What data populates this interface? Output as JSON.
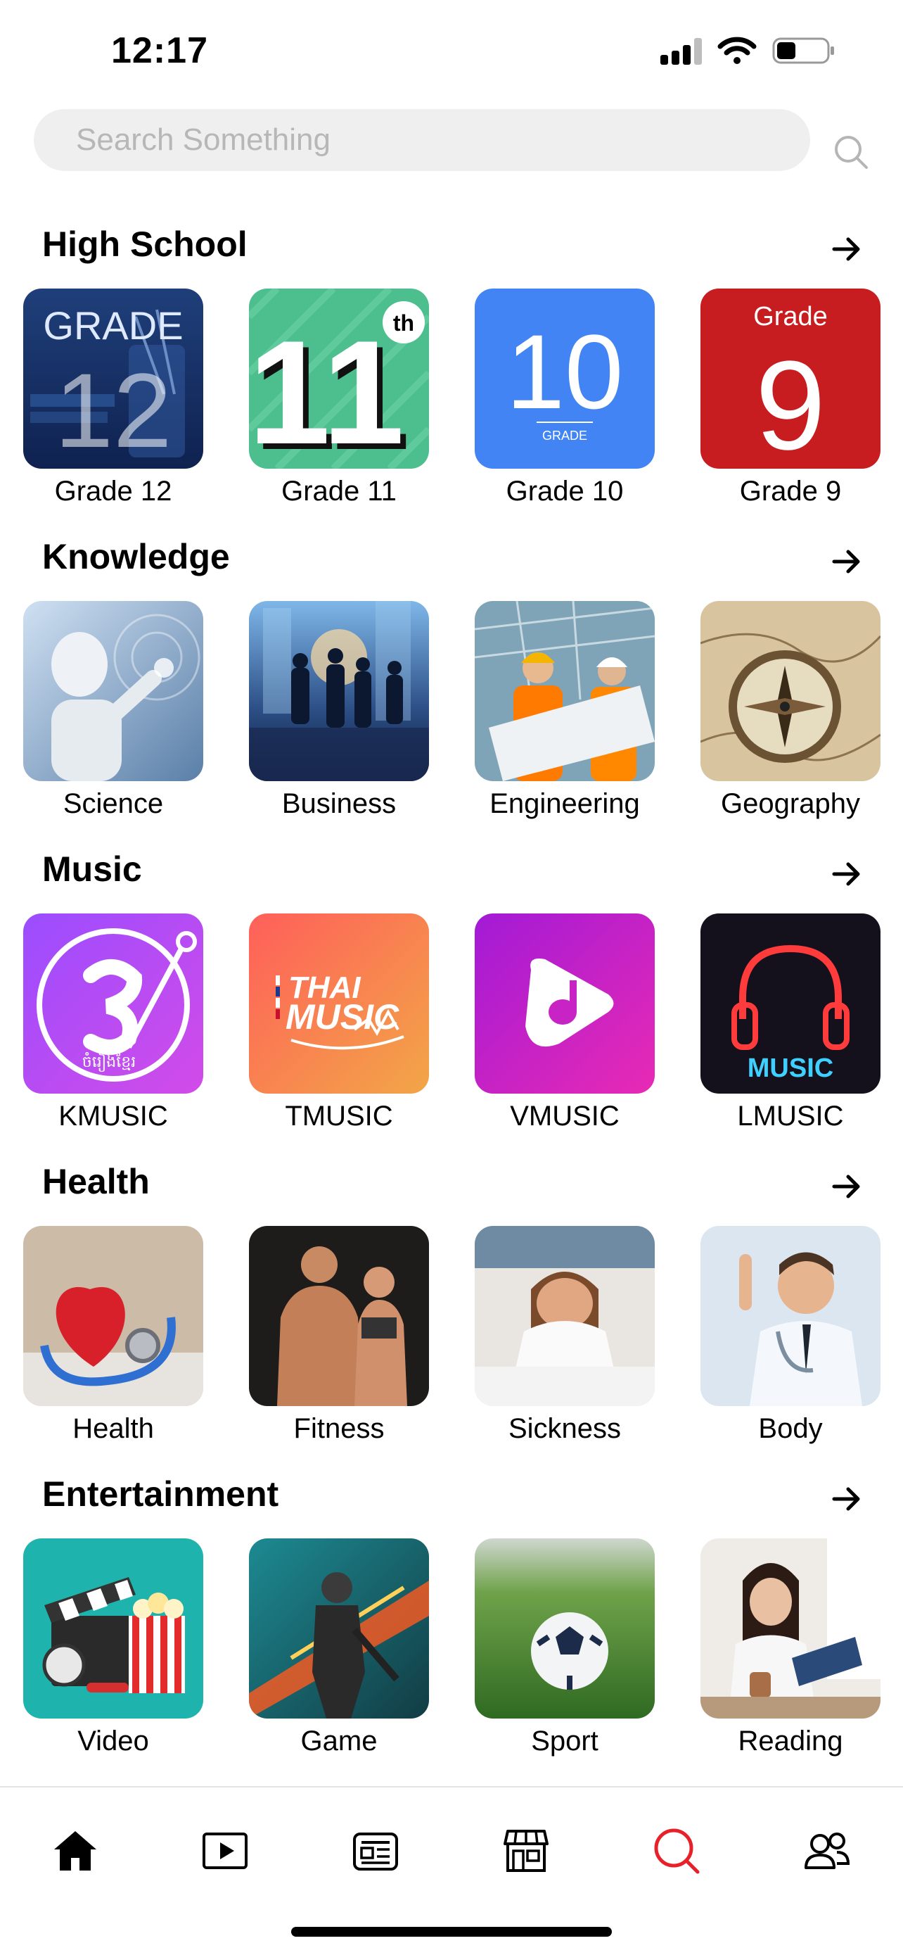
{
  "status_bar": {
    "time": "12:17"
  },
  "search": {
    "placeholder": "Search Something",
    "value": ""
  },
  "sections": [
    {
      "title": "High School",
      "items": [
        {
          "label": "Grade 12",
          "icon": "grade-12-image"
        },
        {
          "label": "Grade 11",
          "icon": "grade-11-image"
        },
        {
          "label": "Grade 10",
          "icon": "grade-10-image"
        },
        {
          "label": "Grade 9",
          "icon": "grade-9-image"
        }
      ]
    },
    {
      "title": "Knowledge",
      "items": [
        {
          "label": "Science",
          "icon": "robot-image"
        },
        {
          "label": "Business",
          "icon": "business-people-image"
        },
        {
          "label": "Engineering",
          "icon": "engineers-image"
        },
        {
          "label": "Geography",
          "icon": "compass-map-image"
        }
      ]
    },
    {
      "title": "Music",
      "items": [
        {
          "label": "KMUSIC",
          "icon": "kmusic-logo"
        },
        {
          "label": "TMUSIC",
          "icon": "thai-music-logo"
        },
        {
          "label": "VMUSIC",
          "icon": "vmusic-logo"
        },
        {
          "label": "LMUSIC",
          "icon": "neon-headphones-logo"
        }
      ]
    },
    {
      "title": "Health",
      "items": [
        {
          "label": "Health",
          "icon": "heart-stethoscope-image"
        },
        {
          "label": "Fitness",
          "icon": "fitness-couple-image"
        },
        {
          "label": "Sickness",
          "icon": "sick-woman-image"
        },
        {
          "label": "Body",
          "icon": "doctor-image"
        }
      ]
    },
    {
      "title": "Entertainment",
      "items": [
        {
          "label": "Video",
          "icon": "clapperboard-popcorn-image"
        },
        {
          "label": "Game",
          "icon": "soldier-game-image"
        },
        {
          "label": "Sport",
          "icon": "soccer-ball-image"
        },
        {
          "label": "Reading",
          "icon": "woman-reading-image"
        }
      ]
    }
  ],
  "tile_art": {
    "grade12": {
      "top": "GRADE",
      "num": "12"
    },
    "grade11": {
      "num": "11",
      "sup": "th"
    },
    "grade10": {
      "num": "10",
      "sub": "GRADE"
    },
    "grade9": {
      "top": "Grade",
      "num": "9"
    },
    "kmusic": {
      "caption": "ចំរៀងខ្មែរ"
    },
    "tmusic": {
      "line1": "THAI",
      "line2": "MUSIC"
    },
    "lmusic": {
      "caption": "MUSIC"
    }
  },
  "bottom_nav": [
    {
      "icon": "home-icon",
      "active": false
    },
    {
      "icon": "play-icon",
      "active": false
    },
    {
      "icon": "news-icon",
      "active": false
    },
    {
      "icon": "store-icon",
      "active": false
    },
    {
      "icon": "search-icon",
      "active": true
    },
    {
      "icon": "users-icon",
      "active": false
    }
  ],
  "colors": {
    "accent": "#e8202a",
    "text": "#000000",
    "search_bg": "#efefef"
  }
}
